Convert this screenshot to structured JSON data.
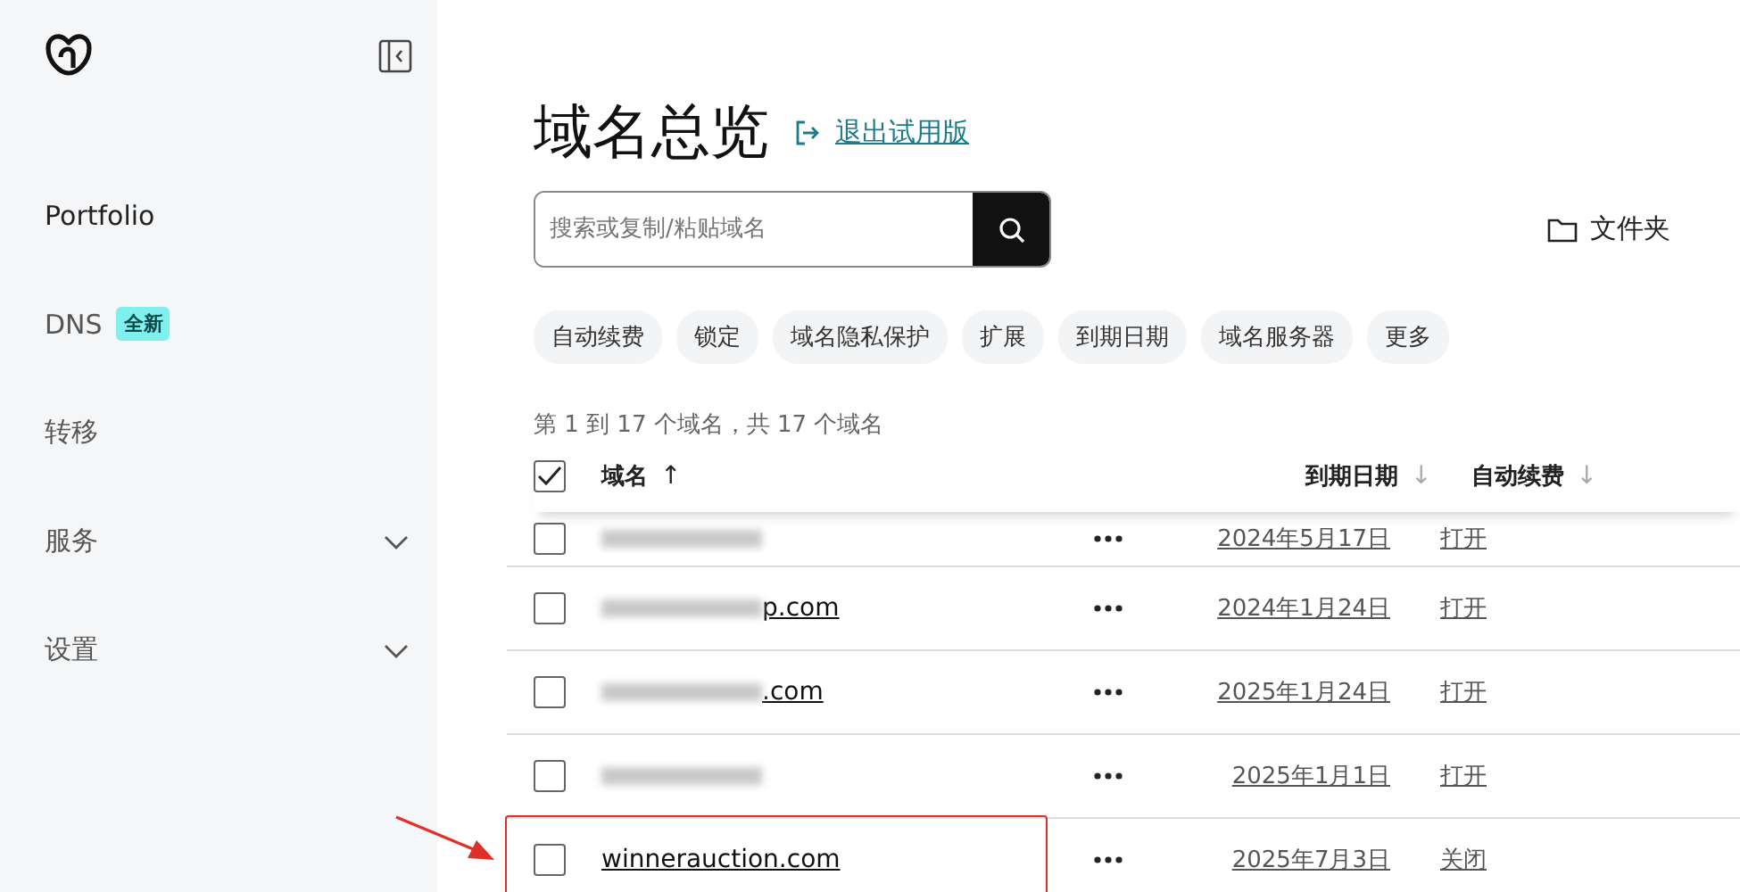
{
  "sidebar": {
    "items": [
      {
        "label": "Portfolio",
        "selected": true
      },
      {
        "label": "DNS",
        "badge": "全新",
        "selected": false
      },
      {
        "label": "转移",
        "selected": false
      },
      {
        "label": "服务",
        "expandable": true,
        "selected": false
      },
      {
        "label": "设置",
        "expandable": true,
        "selected": false
      }
    ]
  },
  "page": {
    "title": "域名总览",
    "exit_link": "退出试用版"
  },
  "search": {
    "placeholder": "搜索或复制/粘贴域名"
  },
  "folder_button": "文件夹",
  "filters": [
    "自动续费",
    "锁定",
    "域名隐私保护",
    "扩展",
    "到期日期",
    "域名服务器",
    "更多"
  ],
  "count_text": "第 1 到 17 个域名，共 17 个域名",
  "table": {
    "select_all_checked": true,
    "columns": [
      {
        "label": "域名",
        "sort": "↑",
        "active": true
      },
      {
        "label": "到期日期",
        "sort": "↓",
        "active": false
      },
      {
        "label": "自动续费",
        "sort": "↓",
        "active": false
      }
    ],
    "rows": [
      {
        "blurred": true,
        "expiry": "2024年5月17日",
        "auto_renew": "打开",
        "checked": false,
        "highlighted": false
      },
      {
        "domain": "p.com",
        "blurred": true,
        "expiry": "2024年1月24日",
        "auto_renew": "打开",
        "checked": false,
        "highlighted": false
      },
      {
        "domain": ".com",
        "blurred": true,
        "expiry": "2025年1月24日",
        "auto_renew": "打开",
        "checked": false,
        "highlighted": false
      },
      {
        "blurred": true,
        "expiry": "2025年1月1日",
        "auto_renew": "打开",
        "checked": false,
        "highlighted": false
      },
      {
        "domain": "winnerauction.com",
        "blurred": false,
        "expiry": "2025年7月3日",
        "auto_renew": "关闭",
        "checked": false,
        "highlighted": true
      }
    ]
  }
}
